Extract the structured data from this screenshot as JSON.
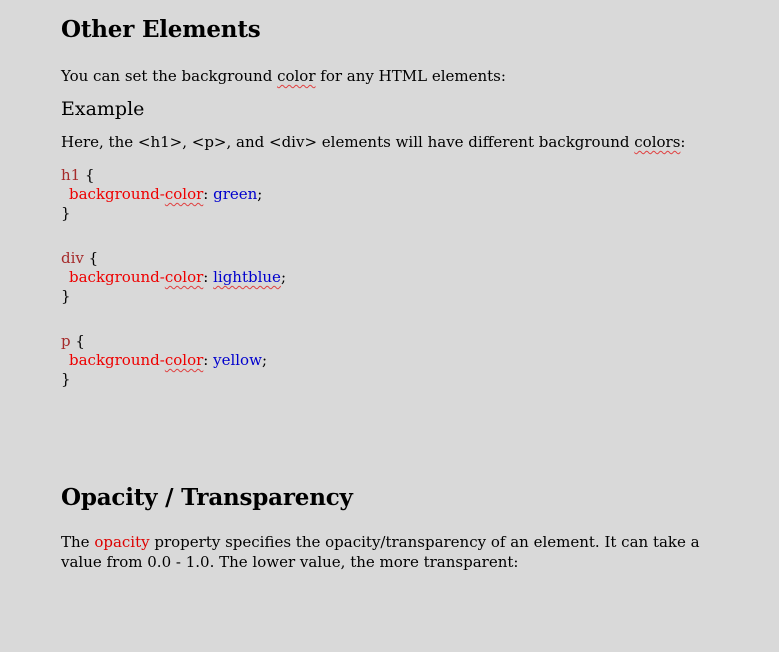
{
  "section1": {
    "heading": "Other Elements",
    "intro_before": "You can set the background ",
    "intro_word": "color",
    "intro_after": " for any HTML elements:",
    "example_heading": "Example",
    "example_desc_before": "Here, the <h1>, <p>, and <div> elements will have different background ",
    "example_desc_word": "colors",
    "example_desc_after": ":"
  },
  "code": [
    {
      "selector": "h1",
      "prop_before": "background-",
      "prop_word": "color",
      "value": "green"
    },
    {
      "selector": "div",
      "prop_before": "background-",
      "prop_word": "color",
      "value": "lightblue"
    },
    {
      "selector": "p",
      "prop_before": "background-",
      "prop_word": "color",
      "value": "yellow"
    }
  ],
  "section2": {
    "heading": "Opacity / Transparency",
    "desc_before": "The ",
    "desc_keyword": "opacity",
    "desc_after": " property specifies the opacity/transparency of an element. It can take a value from 0.0 - 1.0. The lower value, the more transparent:"
  },
  "colors": {
    "background": "#d9d9d9",
    "selector": "#a52a2a",
    "property": "#ee0000",
    "value": "#0000cd",
    "spellcheck_underline": "#e04040"
  }
}
